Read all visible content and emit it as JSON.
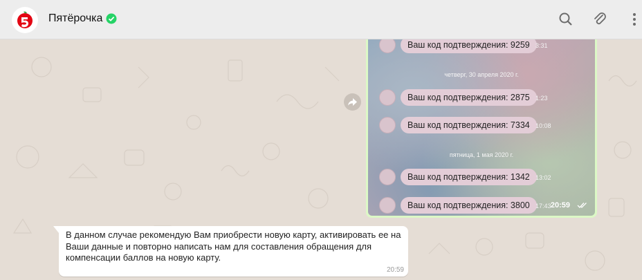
{
  "header": {
    "contact_name": "Пятёрочка",
    "avatar_icon": "pyaterochka-logo",
    "verified_icon": "verified-check-icon",
    "actions": [
      "search-icon",
      "attach-icon",
      "menu-icon"
    ]
  },
  "image_message": {
    "rows": [
      {
        "type": "code",
        "text": "Ваш код подтверждения: 9259",
        "time": "3:31"
      },
      {
        "type": "date",
        "text": "четверг, 30 апреля 2020 г."
      },
      {
        "type": "code",
        "text": "Ваш код подтверждения: 2875",
        "time": "1:23"
      },
      {
        "type": "code",
        "text": "Ваш код подтверждения: 7334",
        "time": "10:08"
      },
      {
        "type": "date",
        "text": "пятница, 1 мая 2020 г."
      },
      {
        "type": "code",
        "text": "Ваш код подтверждения: 1342",
        "time": "13:02"
      },
      {
        "type": "code",
        "text": "Ваш код подтверждения: 3800",
        "time": "17:43"
      }
    ],
    "time": "20:59",
    "status_icon": "double-check-icon"
  },
  "text_message": {
    "text": "В данном случае рекомендую Вам приобрести новую карту, активировать ее на Ваши данные и повторно написать нам для составления обращения для компенсации баллов на новую карту.",
    "time": "20:59"
  },
  "colors": {
    "header_bg": "#ededed",
    "chat_bg": "#e5ddd5",
    "outgoing_bg": "#dcf8c6",
    "incoming_bg": "#ffffff",
    "verified": "#25d366",
    "brand_red": "#e30613"
  }
}
